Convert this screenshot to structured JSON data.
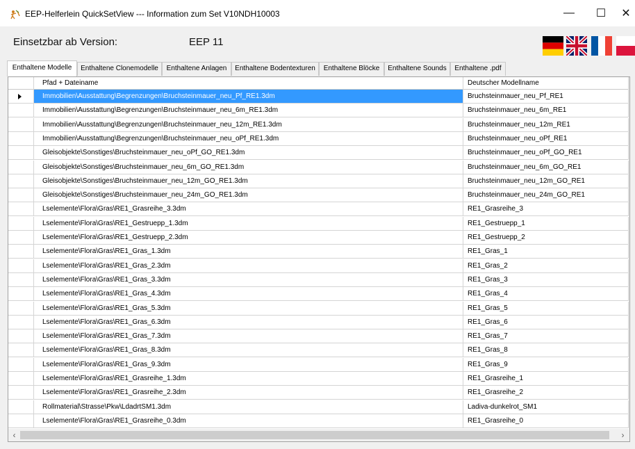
{
  "window": {
    "title": "EEP-Helferlein QuickSetView --- Information zum Set V10NDH10003",
    "minimize_glyph": "—",
    "maximize_glyph": "☐",
    "close_glyph": "✕"
  },
  "header": {
    "version_label": "Einsetzbar ab Version:",
    "version_value": "EEP 11"
  },
  "flags": [
    "flag-de-icon",
    "flag-gb-icon",
    "flag-fr-icon",
    "flag-pl-icon"
  ],
  "tabs": [
    {
      "label": "Enthaltene Modelle",
      "active": true
    },
    {
      "label": "Enthaltene Clonemodelle",
      "active": false
    },
    {
      "label": "Enthaltene Anlagen",
      "active": false
    },
    {
      "label": "Enthaltene Bodentexturen",
      "active": false
    },
    {
      "label": "Enthaltene Blöcke",
      "active": false
    },
    {
      "label": "Enthaltene Sounds",
      "active": false
    },
    {
      "label": "Enthaltene .pdf",
      "active": false
    }
  ],
  "grid": {
    "columns": [
      "Pfad + Dateiname",
      "Deutscher Modellname"
    ],
    "selected_row": 0,
    "rows": [
      [
        "Immobilien\\Ausstattung\\Begrenzungen\\Bruchsteinmauer_neu_Pf_RE1.3dm",
        "Bruchsteinmauer_neu_Pf_RE1"
      ],
      [
        "Immobilien\\Ausstattung\\Begrenzungen\\Bruchsteinmauer_neu_6m_RE1.3dm",
        "Bruchsteinmauer_neu_6m_RE1"
      ],
      [
        "Immobilien\\Ausstattung\\Begrenzungen\\Bruchsteinmauer_neu_12m_RE1.3dm",
        "Bruchsteinmauer_neu_12m_RE1"
      ],
      [
        "Immobilien\\Ausstattung\\Begrenzungen\\Bruchsteinmauer_neu_oPf_RE1.3dm",
        "Bruchsteinmauer_neu_oPf_RE1"
      ],
      [
        "Gleisobjekte\\Sonstiges\\Bruchsteinmauer_neu_oPf_GO_RE1.3dm",
        "Bruchsteinmauer_neu_oPf_GO_RE1"
      ],
      [
        "Gleisobjekte\\Sonstiges\\Bruchsteinmauer_neu_6m_GO_RE1.3dm",
        "Bruchsteinmauer_neu_6m_GO_RE1"
      ],
      [
        "Gleisobjekte\\Sonstiges\\Bruchsteinmauer_neu_12m_GO_RE1.3dm",
        "Bruchsteinmauer_neu_12m_GO_RE1"
      ],
      [
        "Gleisobjekte\\Sonstiges\\Bruchsteinmauer_neu_24m_GO_RE1.3dm",
        "Bruchsteinmauer_neu_24m_GO_RE1"
      ],
      [
        "Lselemente\\Flora\\Gras\\RE1_Grasreihe_3.3dm",
        "RE1_Grasreihe_3"
      ],
      [
        "Lselemente\\Flora\\Gras\\RE1_Gestruepp_1.3dm",
        "RE1_Gestruepp_1"
      ],
      [
        "Lselemente\\Flora\\Gras\\RE1_Gestruepp_2.3dm",
        "RE1_Gestruepp_2"
      ],
      [
        "Lselemente\\Flora\\Gras\\RE1_Gras_1.3dm",
        "RE1_Gras_1"
      ],
      [
        "Lselemente\\Flora\\Gras\\RE1_Gras_2.3dm",
        "RE1_Gras_2"
      ],
      [
        "Lselemente\\Flora\\Gras\\RE1_Gras_3.3dm",
        "RE1_Gras_3"
      ],
      [
        "Lselemente\\Flora\\Gras\\RE1_Gras_4.3dm",
        "RE1_Gras_4"
      ],
      [
        "Lselemente\\Flora\\Gras\\RE1_Gras_5.3dm",
        "RE1_Gras_5"
      ],
      [
        "Lselemente\\Flora\\Gras\\RE1_Gras_6.3dm",
        "RE1_Gras_6"
      ],
      [
        "Lselemente\\Flora\\Gras\\RE1_Gras_7.3dm",
        "RE1_Gras_7"
      ],
      [
        "Lselemente\\Flora\\Gras\\RE1_Gras_8.3dm",
        "RE1_Gras_8"
      ],
      [
        "Lselemente\\Flora\\Gras\\RE1_Gras_9.3dm",
        "RE1_Gras_9"
      ],
      [
        "Lselemente\\Flora\\Gras\\RE1_Grasreihe_1.3dm",
        "RE1_Grasreihe_1"
      ],
      [
        "Lselemente\\Flora\\Gras\\RE1_Grasreihe_2.3dm",
        "RE1_Grasreihe_2"
      ],
      [
        "Rollmaterial\\Strasse\\Pkw\\LdadrtSM1.3dm",
        "Ladiva-dunkelrot_SM1"
      ],
      [
        "Lselemente\\Flora\\Gras\\RE1_Grasreihe_0.3dm",
        "RE1_Grasreihe_0"
      ]
    ]
  },
  "scrollbars": {
    "up": "▲",
    "down": "▼",
    "left": "‹",
    "right": "›"
  }
}
